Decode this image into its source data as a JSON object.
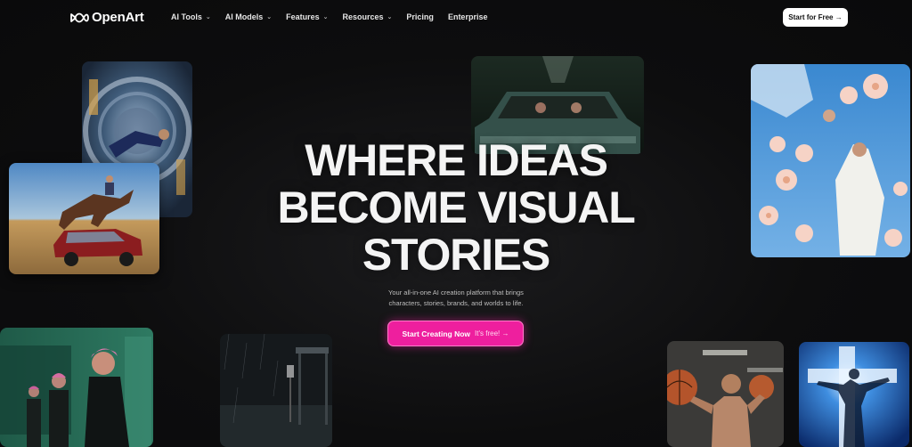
{
  "nav": {
    "brand": "OpenArt",
    "items": [
      {
        "label": "AI Tools",
        "dropdown": true
      },
      {
        "label": "AI Models",
        "dropdown": true
      },
      {
        "label": "Features",
        "dropdown": true
      },
      {
        "label": "Resources",
        "dropdown": true
      },
      {
        "label": "Pricing",
        "dropdown": false
      },
      {
        "label": "Enterprise",
        "dropdown": false
      }
    ],
    "cta_label": "Start for Free →"
  },
  "hero": {
    "title_lines": [
      "WHERE IDEAS",
      "BECOME VISUAL",
      "STORIES"
    ],
    "subtitle_lines": [
      "Your all-in-one AI creation platform that brings",
      "characters, stories, brands, and worlds to life."
    ],
    "cta_main": "Start Creating Now",
    "cta_free": "It's free! →"
  },
  "colors": {
    "background": "#0b0b0c",
    "cta_pink": "#ee1f9e",
    "text": "#ffffff"
  },
  "icons": {
    "logo": "openart-infinity-logo",
    "caret": "chevron-down-icon"
  }
}
